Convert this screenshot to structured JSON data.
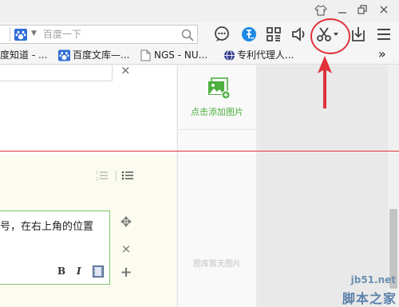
{
  "search": {
    "placeholder": "百度一下"
  },
  "toolbar": {
    "icons": [
      "chat-icon",
      "coupon-icon",
      "apps-grid-icon",
      "speaker-icon",
      "scissors-icon",
      "download-icon",
      "menu-icon"
    ]
  },
  "bookmarks": {
    "items": [
      {
        "label": "度知道 - ...",
        "icon": "baidu-paw-icon"
      },
      {
        "label": "百度文库—...",
        "icon": "baidu-paw-icon"
      },
      {
        "label": "NGS - NU...",
        "icon": "document-icon"
      },
      {
        "label": "专利代理人...",
        "icon": "globe-icon"
      }
    ],
    "overflow": "»"
  },
  "editor": {
    "close_symbol": "×",
    "text_line": "号，在右上角的位置",
    "format": {
      "bold": "B",
      "italic": "I"
    },
    "side_tools": {
      "move": "✥",
      "remove": "×",
      "add": "+"
    }
  },
  "gallery": {
    "add_label": "点击添加图片",
    "empty_label": "图库暂无图片"
  },
  "watermark": {
    "site": "jb51.net",
    "name": "脚本之家"
  },
  "colors": {
    "accent_red": "#e0323a",
    "baidu_blue": "#2f6ed8",
    "green": "#4caf3e"
  }
}
